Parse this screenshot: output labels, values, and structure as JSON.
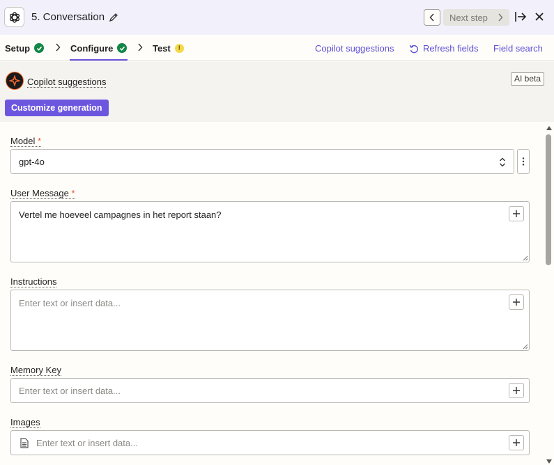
{
  "header": {
    "title": "5. Conversation",
    "next_step_label": "Next step"
  },
  "tabs": [
    {
      "label": "Setup",
      "status": "complete"
    },
    {
      "label": "Configure",
      "status": "complete"
    },
    {
      "label": "Test",
      "status": "warning"
    }
  ],
  "tab_status": {
    "warning_glyph": "!"
  },
  "links": {
    "copilot_suggestions": "Copilot suggestions",
    "refresh_fields": "Refresh fields",
    "field_search": "Field search"
  },
  "copilot": {
    "title": "Copilot suggestions",
    "badge": "AI beta",
    "customize_button": "Customize generation"
  },
  "form": {
    "required_marker": "*",
    "model": {
      "label": "Model",
      "value": "gpt-4o"
    },
    "user_message": {
      "label": "User Message",
      "value": "Vertel me hoeveel campagnes in het report staan?"
    },
    "instructions": {
      "label": "Instructions",
      "placeholder": "Enter text or insert data..."
    },
    "memory_key": {
      "label": "Memory Key",
      "placeholder": "Enter text or insert data..."
    },
    "images": {
      "label": "Images",
      "placeholder": "Enter text or insert data..."
    }
  },
  "colors": {
    "accent": "#6c56e0",
    "link": "#5b4fd6",
    "success": "#128746",
    "warning": "#f3d94a",
    "required": "#e3562b"
  },
  "icons": [
    "openai-icon",
    "pencil-icon",
    "chevron-left-icon",
    "chevron-right-icon",
    "exit-icon",
    "close-icon",
    "check-icon",
    "warning-icon",
    "refresh-icon",
    "copilot-icon",
    "updown-icon",
    "kebab-icon",
    "plus-icon",
    "document-icon"
  ]
}
